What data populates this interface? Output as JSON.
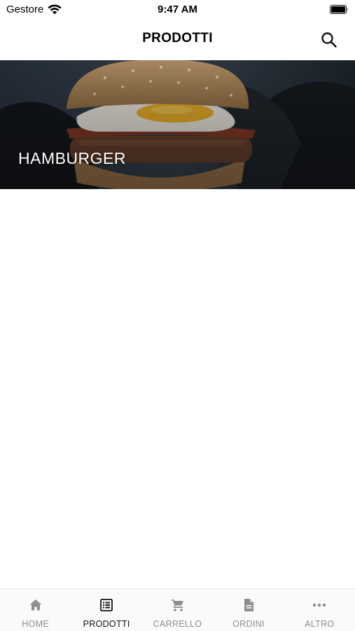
{
  "status_bar": {
    "carrier": "Gestore",
    "time": "9:47 AM"
  },
  "header": {
    "title": "PRODOTTI",
    "search_icon": "search-icon"
  },
  "categories": [
    {
      "label": "HAMBURGER",
      "image": "hamburger-photo"
    }
  ],
  "tab_bar": {
    "tabs": [
      {
        "label": "HOME",
        "icon": "home-icon",
        "active": false
      },
      {
        "label": "PRODOTTI",
        "icon": "list-icon",
        "active": true
      },
      {
        "label": "CARRELLO",
        "icon": "cart-icon",
        "active": false
      },
      {
        "label": "ORDINI",
        "icon": "document-icon",
        "active": false
      },
      {
        "label": "ALTRO",
        "icon": "more-icon",
        "active": false
      }
    ],
    "colors": {
      "active": "#111111",
      "inactive": "#8e8e8e"
    }
  }
}
